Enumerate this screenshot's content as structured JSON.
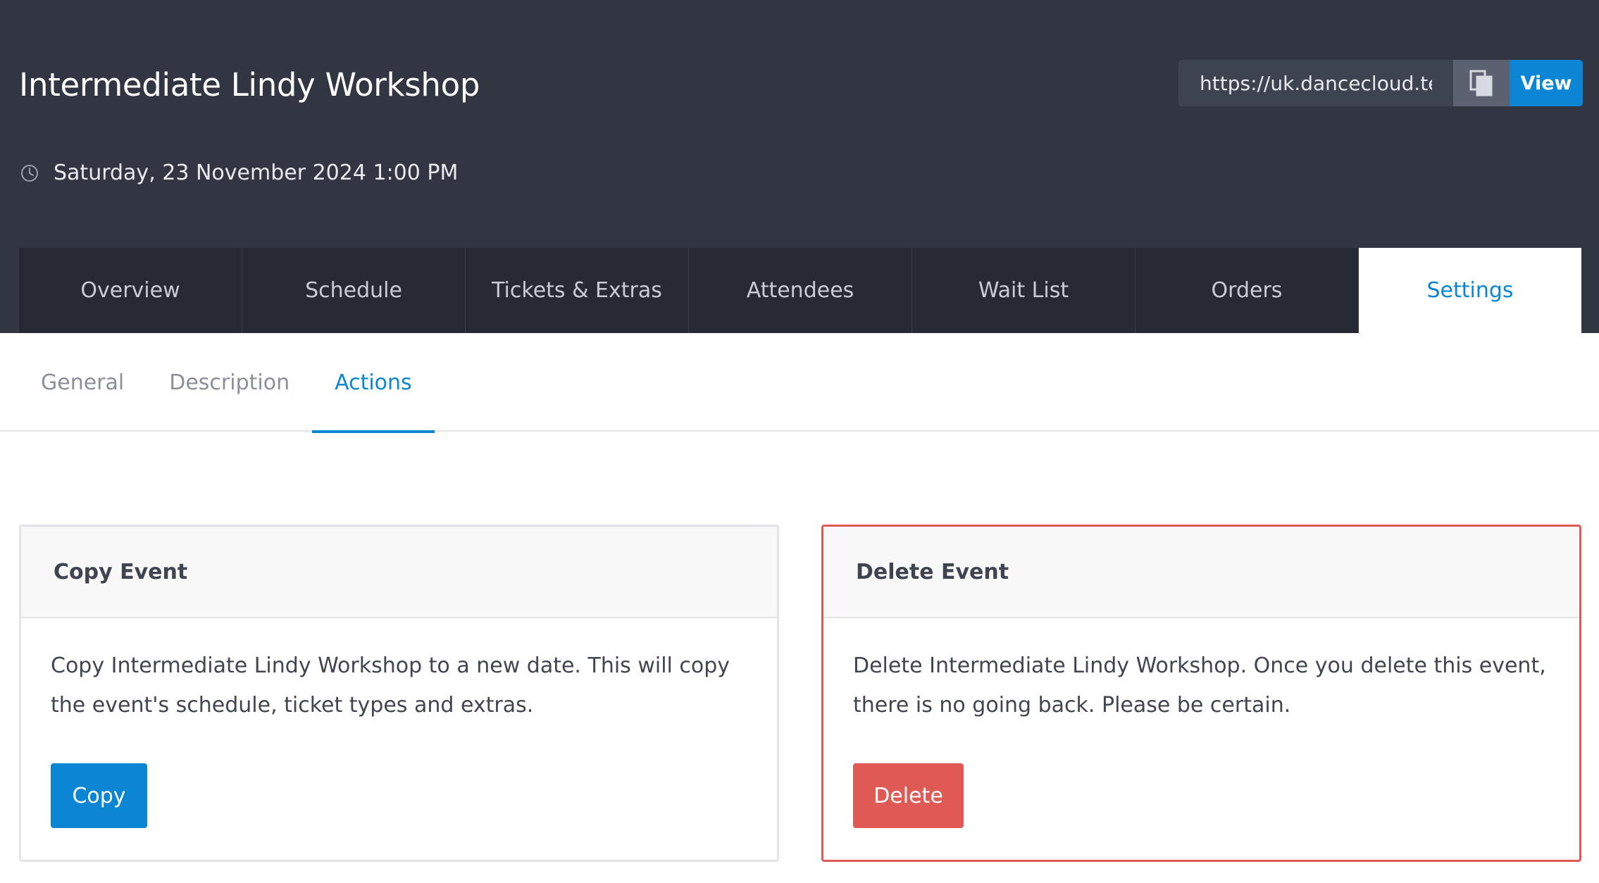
{
  "event": {
    "title": "Intermediate Lindy Workshop",
    "datetime": "Saturday, 23 November 2024 1:00 PM",
    "public_url": "https://uk.dancecloud.te",
    "view_label": "View"
  },
  "main_tabs": [
    {
      "label": "Overview"
    },
    {
      "label": "Schedule"
    },
    {
      "label": "Tickets & Extras"
    },
    {
      "label": "Attendees"
    },
    {
      "label": "Wait List"
    },
    {
      "label": "Orders"
    },
    {
      "label": "Settings",
      "active": true
    }
  ],
  "sub_tabs": [
    {
      "label": "General"
    },
    {
      "label": "Description"
    },
    {
      "label": "Actions",
      "active": true
    }
  ],
  "copy_card": {
    "title": "Copy Event",
    "text": "Copy Intermediate Lindy Workshop to a new date. This will copy the event's schedule, ticket types and extras.",
    "button": "Copy"
  },
  "delete_card": {
    "title": "Delete Event",
    "text": "Delete Intermediate Lindy Workshop. Once you delete this event, there is no going back. Please be certain.",
    "button": "Delete"
  },
  "colors": {
    "header_bg": "#323642",
    "tab_bg": "#272a35",
    "accent": "#0a86d4",
    "danger": "#e05a55"
  },
  "icons": {
    "clock": "clock-icon",
    "copy_url": "copy-icon"
  }
}
